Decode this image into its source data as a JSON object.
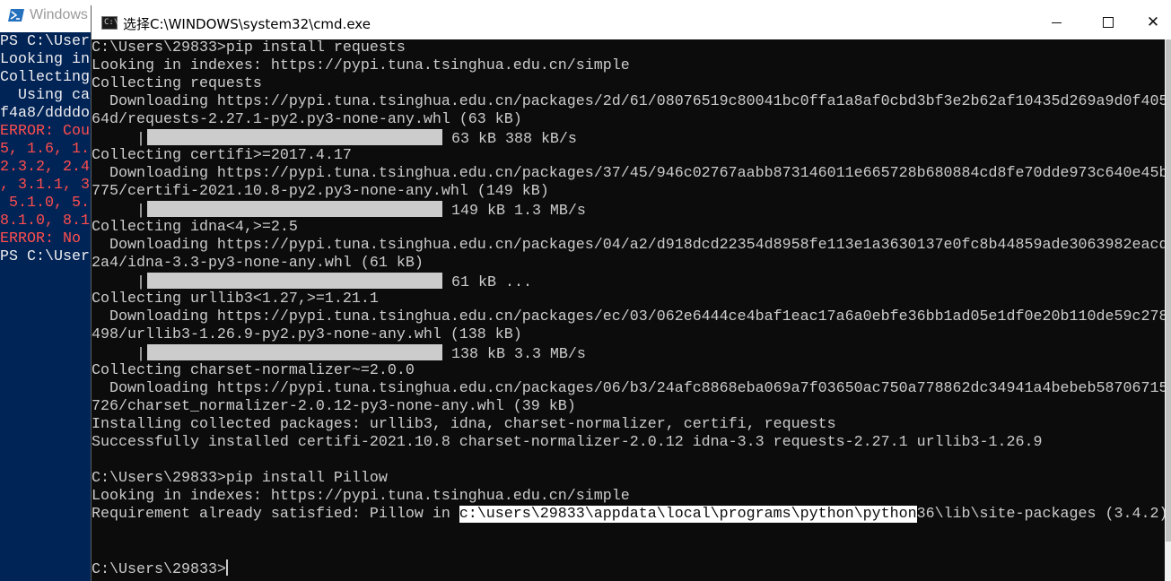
{
  "ps": {
    "title": "Windows",
    "lines": [
      {
        "text": "PS C:\\Users",
        "kind": "normal"
      },
      {
        "text": "Looking in",
        "kind": "normal"
      },
      {
        "text": "Collecting",
        "kind": "normal"
      },
      {
        "text": "  Using ca",
        "kind": "normal"
      },
      {
        "text": "f4a8/ddddo",
        "kind": "normal"
      },
      {
        "text": "ERROR: Cou",
        "kind": "error"
      },
      {
        "text": "5, 1.6, 1.",
        "kind": "error"
      },
      {
        "text": "2.3.2, 2.4",
        "kind": "error"
      },
      {
        "text": ", 3.1.1, 3",
        "kind": "error"
      },
      {
        "text": " 5.1.0, 5.",
        "kind": "error"
      },
      {
        "text": "8.1.0, 8.1",
        "kind": "error"
      },
      {
        "text": "ERROR: No ",
        "kind": "error"
      },
      {
        "text": "PS C:\\User",
        "kind": "normal"
      }
    ]
  },
  "cmd": {
    "title": "选择C:\\WINDOWS\\system32\\cmd.exe",
    "close_glyph": "✕",
    "lines": [
      {
        "text": "C:\\Users\\29833>pip install requests"
      },
      {
        "text": "Looking in indexes: https://pypi.tuna.tsinghua.edu.cn/simple"
      },
      {
        "text": "Collecting requests"
      },
      {
        "text": "  Downloading https://pypi.tuna.tsinghua.edu.cn/packages/2d/61/08076519c80041bc0ffa1a8af0cbd3bf3e2b62af10435d269a9d0f405"
      },
      {
        "text": "64d/requests-2.27.1-py2.py3-none-any.whl (63 kB)"
      },
      {
        "progress": true,
        "prefix": "     |",
        "fraction": 1.0,
        "status": "63 kB 388 kB/s"
      },
      {
        "text": "Collecting certifi>=2017.4.17"
      },
      {
        "text": "  Downloading https://pypi.tuna.tsinghua.edu.cn/packages/37/45/946c02767aabb873146011e665728b680884cd8fe70dde973c640e45b"
      },
      {
        "text": "775/certifi-2021.10.8-py2.py3-none-any.whl (149 kB)"
      },
      {
        "progress": true,
        "prefix": "     |",
        "fraction": 1.0,
        "status": "149 kB 1.3 MB/s"
      },
      {
        "text": "Collecting idna<4,>=2.5"
      },
      {
        "text": "  Downloading https://pypi.tuna.tsinghua.edu.cn/packages/04/a2/d918dcd22354d8958fe113e1a3630137e0fc8b44859ade3063982eacd"
      },
      {
        "text": "2a4/idna-3.3-py3-none-any.whl (61 kB)"
      },
      {
        "progress": true,
        "prefix": "     |",
        "fraction": 1.0,
        "status": "61 kB ..."
      },
      {
        "text": "Collecting urllib3<1.27,>=1.21.1"
      },
      {
        "text": "  Downloading https://pypi.tuna.tsinghua.edu.cn/packages/ec/03/062e6444ce4baf1eac17a6a0ebfe36bb1ad05e1df0e20b110de59c278"
      },
      {
        "text": "498/urllib3-1.26.9-py2.py3-none-any.whl (138 kB)"
      },
      {
        "progress": true,
        "prefix": "     |",
        "fraction": 1.0,
        "status": "138 kB 3.3 MB/s"
      },
      {
        "text": "Collecting charset-normalizer~=2.0.0"
      },
      {
        "text": "  Downloading https://pypi.tuna.tsinghua.edu.cn/packages/06/b3/24afc8868eba069a7f03650ac750a778862dc34941a4bebeb58706715"
      },
      {
        "text": "726/charset_normalizer-2.0.12-py3-none-any.whl (39 kB)"
      },
      {
        "text": "Installing collected packages: urllib3, idna, charset-normalizer, certifi, requests"
      },
      {
        "text": "Successfully installed certifi-2021.10.8 charset-normalizer-2.0.12 idna-3.3 requests-2.27.1 urllib3-1.26.9"
      },
      {
        "text": ""
      },
      {
        "text": "C:\\Users\\29833>pip install Pillow"
      },
      {
        "text": "Looking in indexes: https://pypi.tuna.tsinghua.edu.cn/simple"
      },
      {
        "segments": [
          {
            "text": "Requirement already satisfied: Pillow in ",
            "selected": false
          },
          {
            "text": "c:\\users\\29833\\appdata\\local\\programs\\python\\python",
            "selected": true
          },
          {
            "text": "36\\lib\\site-packages (3.4.2)",
            "selected": false
          }
        ]
      },
      {
        "text": ""
      },
      {
        "text": ""
      },
      {
        "text": "C:\\Users\\29833>",
        "cursor": true
      }
    ]
  }
}
